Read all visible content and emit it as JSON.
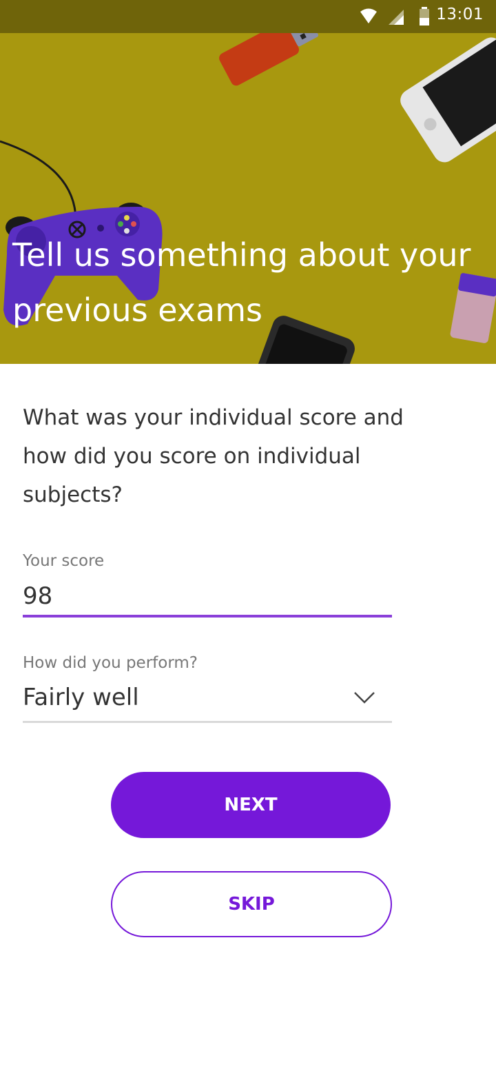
{
  "status_bar": {
    "time": "13:01",
    "icons": [
      "wifi-icon",
      "signal-icon",
      "battery-icon"
    ]
  },
  "header": {
    "title": "Tell us something about your previous exams",
    "background_color": "#a8980f"
  },
  "question": {
    "text": "What was your individual score and how did you score on individual subjects?"
  },
  "score_field": {
    "label": "Your score",
    "value": "98"
  },
  "performance_field": {
    "label": "How did you perform?",
    "value": "Fairly well"
  },
  "buttons": {
    "next_label": "NEXT",
    "skip_label": "SKIP"
  },
  "colors": {
    "accent": "#7518d9",
    "input_underline": "#8a3fd9"
  }
}
